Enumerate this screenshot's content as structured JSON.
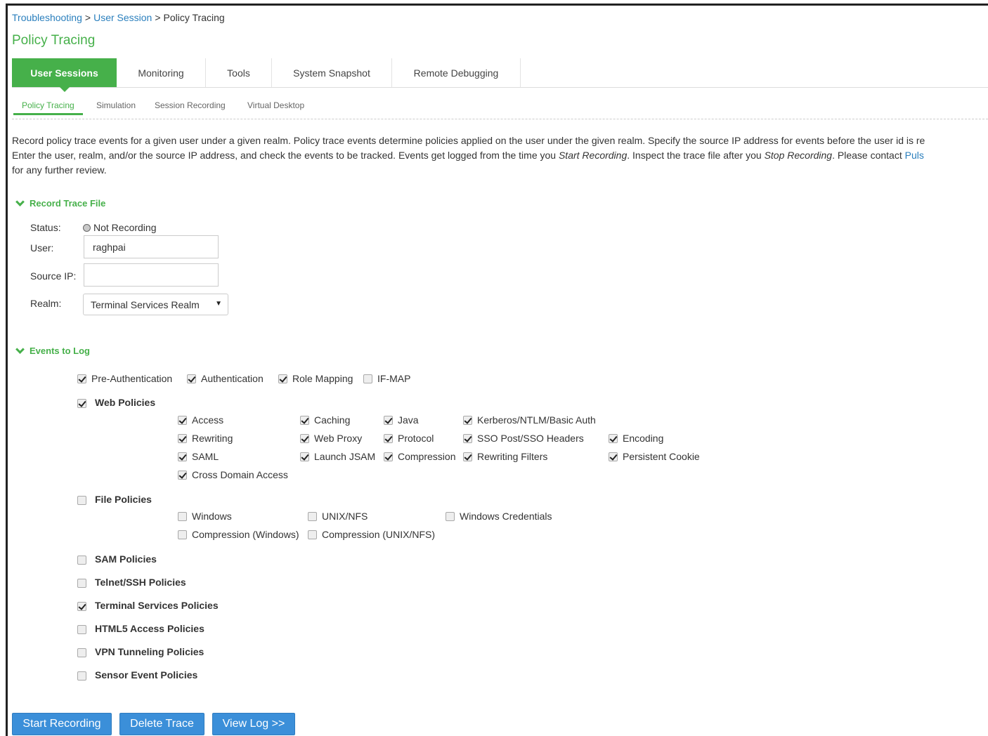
{
  "breadcrumb": {
    "items": [
      "Troubleshooting",
      "User Session"
    ],
    "separator": ">",
    "current": "Policy Tracing"
  },
  "page_title": "Policy Tracing",
  "tabs": [
    {
      "label": "User Sessions",
      "active": true
    },
    {
      "label": "Monitoring"
    },
    {
      "label": "Tools"
    },
    {
      "label": "System Snapshot"
    },
    {
      "label": "Remote Debugging"
    }
  ],
  "subtabs": [
    {
      "label": "Policy Tracing",
      "active": true
    },
    {
      "label": "Simulation"
    },
    {
      "label": "Session Recording"
    },
    {
      "label": "Virtual Desktop"
    }
  ],
  "description": {
    "line1": "Record policy trace events for a given user under a given realm. Policy trace events determine policies applied on the user under the given realm. Specify the source IP address for events before the user id is re",
    "line2_a": "Enter the user, realm, and/or the source IP address, and check the events to be tracked. Events get logged from the time you ",
    "line2_em1": "Start Recording",
    "line2_b": ". Inspect the trace file after you ",
    "line2_em2": "Stop Recording",
    "line2_c": ". Please contact ",
    "line2_link": "Puls",
    "line3": "for any further review."
  },
  "record_section": {
    "title": "Record Trace File",
    "status_label": "Status:",
    "status_value": "Not Recording",
    "user_label": "User:",
    "user_value": "raghpai",
    "source_ip_label": "Source IP:",
    "source_ip_value": "",
    "realm_label": "Realm:",
    "realm_value": "Terminal Services Realm",
    "realm_arrow": "▼"
  },
  "events_section": {
    "title": "Events to Log",
    "top_events": [
      {
        "label": "Pre-Authentication",
        "checked": true
      },
      {
        "label": "Authentication",
        "checked": true
      },
      {
        "label": "Role Mapping",
        "checked": true
      },
      {
        "label": "IF-MAP",
        "checked": false
      }
    ],
    "web_policies": {
      "label": "Web Policies",
      "checked": true,
      "items": [
        {
          "label": "Access",
          "checked": true
        },
        {
          "label": "Caching",
          "checked": true
        },
        {
          "label": "Java",
          "checked": true
        },
        {
          "label": "Kerberos/NTLM/Basic Auth",
          "checked": true
        },
        {
          "label": "Rewriting",
          "checked": true
        },
        {
          "label": "Web Proxy",
          "checked": true
        },
        {
          "label": "Protocol",
          "checked": true
        },
        {
          "label": "SSO Post/SSO Headers",
          "checked": true
        },
        {
          "label": "Encoding",
          "checked": true
        },
        {
          "label": "SAML",
          "checked": true
        },
        {
          "label": "Launch JSAM",
          "checked": true
        },
        {
          "label": "Compression",
          "checked": true
        },
        {
          "label": "Rewriting Filters",
          "checked": true
        },
        {
          "label": "Persistent Cookie",
          "checked": true
        },
        {
          "label": "Cross Domain Access",
          "checked": true
        }
      ]
    },
    "file_policies": {
      "label": "File Policies",
      "checked": false,
      "items": [
        {
          "label": "Windows",
          "checked": false
        },
        {
          "label": "UNIX/NFS",
          "checked": false
        },
        {
          "label": "Windows Credentials",
          "checked": false
        },
        {
          "label": "Compression (Windows)",
          "checked": false
        },
        {
          "label": "Compression (UNIX/NFS)",
          "checked": false
        }
      ]
    },
    "other_policies": [
      {
        "label": "SAM Policies",
        "checked": false
      },
      {
        "label": "Telnet/SSH Policies",
        "checked": false
      },
      {
        "label": "Terminal Services Policies",
        "checked": true
      },
      {
        "label": "HTML5 Access Policies",
        "checked": false
      },
      {
        "label": "VPN Tunneling Policies",
        "checked": false
      },
      {
        "label": "Sensor Event Policies",
        "checked": false
      }
    ]
  },
  "buttons": {
    "start": "Start Recording",
    "delete": "Delete Trace",
    "view_log": "View Log >>"
  },
  "colors": {
    "accent_green": "#46b04a",
    "link_blue": "#2a7fbd",
    "button_blue": "#3b8fd9"
  }
}
